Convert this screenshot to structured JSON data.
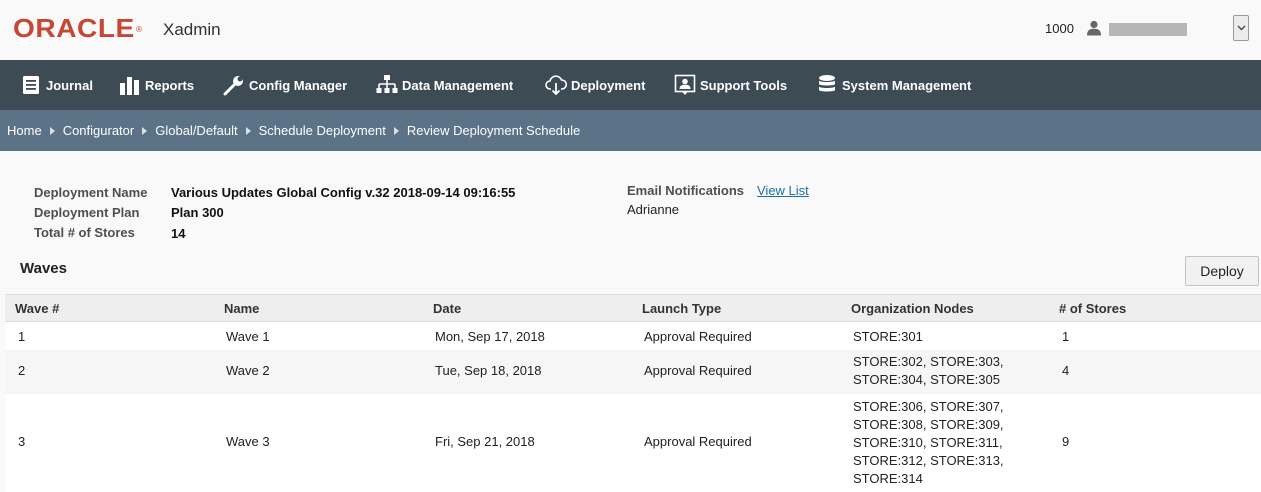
{
  "header": {
    "logo": "ORACLE",
    "logo_mark": "®",
    "app_name": "Xadmin",
    "store_number": "1000"
  },
  "nav": [
    {
      "label": "Journal",
      "icon": "journal-icon"
    },
    {
      "label": "Reports",
      "icon": "bar-chart-icon"
    },
    {
      "label": "Config Manager",
      "icon": "wrench-icon"
    },
    {
      "label": "Data Management",
      "icon": "hierarchy-icon"
    },
    {
      "label": "Deployment",
      "icon": "cloud-download-icon"
    },
    {
      "label": "Support Tools",
      "icon": "support-icon"
    },
    {
      "label": "System Management",
      "icon": "database-icon"
    }
  ],
  "breadcrumb": [
    "Home",
    "Configurator",
    "Global/Default",
    "Schedule Deployment",
    "Review Deployment Schedule"
  ],
  "summary": {
    "deployment_name_label": "Deployment Name",
    "deployment_name": "Various Updates Global Config v.32 2018-09-14 09:16:55",
    "deployment_plan_label": "Deployment Plan",
    "deployment_plan": "Plan 300",
    "total_stores_label": "Total # of Stores",
    "total_stores": "14",
    "email_label": "Email Notifications",
    "email_link": "View List",
    "email_recipient": "Adrianne"
  },
  "waves": {
    "title": "Waves",
    "deploy_label": "Deploy",
    "columns": [
      "Wave #",
      "Name",
      "Date",
      "Launch Type",
      "Organization Nodes",
      "# of Stores"
    ],
    "rows": [
      {
        "wave": "1",
        "name": "Wave 1",
        "date": "Mon, Sep 17, 2018",
        "launch": "Approval Required",
        "nodes": [
          "STORE:301"
        ],
        "stores": "1"
      },
      {
        "wave": "2",
        "name": "Wave 2",
        "date": "Tue, Sep 18, 2018",
        "launch": "Approval Required",
        "nodes": [
          "STORE:302, STORE:303,",
          "STORE:304, STORE:305"
        ],
        "stores": "4"
      },
      {
        "wave": "3",
        "name": "Wave 3",
        "date": "Fri, Sep 21, 2018",
        "launch": "Approval Required",
        "nodes": [
          "STORE:306, STORE:307,",
          "STORE:308, STORE:309,",
          "STORE:310, STORE:311,",
          "STORE:312, STORE:313,",
          "STORE:314"
        ],
        "stores": "9"
      }
    ]
  },
  "colors": {
    "brand_red": "#c74634",
    "nav_bg": "#3d4b55",
    "breadcrumb_bg": "#5c7286",
    "link": "#1a6fa8"
  }
}
